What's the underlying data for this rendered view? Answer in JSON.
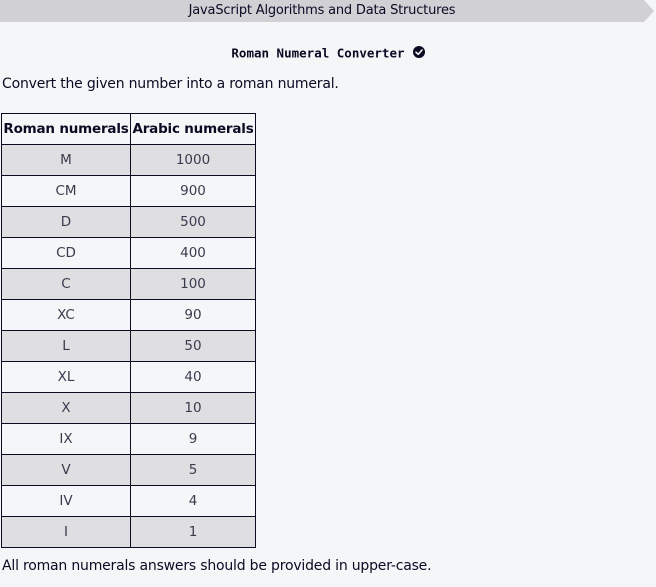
{
  "breadcrumb": {
    "text": "JavaScript Algorithms and Data Structures"
  },
  "challenge": {
    "title": "Roman Numeral Converter",
    "completed": true
  },
  "description": {
    "intro": "Convert the given number into a roman numeral.",
    "footer": "All roman numerals answers should be provided in upper-case."
  },
  "table": {
    "headers": [
      "Roman numerals",
      "Arabic numerals"
    ],
    "rows": [
      {
        "roman": "M",
        "arabic": "1000"
      },
      {
        "roman": "CM",
        "arabic": "900"
      },
      {
        "roman": "D",
        "arabic": "500"
      },
      {
        "roman": "CD",
        "arabic": "400"
      },
      {
        "roman": "C",
        "arabic": "100"
      },
      {
        "roman": "XC",
        "arabic": "90"
      },
      {
        "roman": "L",
        "arabic": "50"
      },
      {
        "roman": "XL",
        "arabic": "40"
      },
      {
        "roman": "X",
        "arabic": "10"
      },
      {
        "roman": "IX",
        "arabic": "9"
      },
      {
        "roman": "V",
        "arabic": "5"
      },
      {
        "roman": "IV",
        "arabic": "4"
      },
      {
        "roman": "I",
        "arabic": "1"
      }
    ]
  },
  "colors": {
    "background": "#f5f6f7",
    "breadcrumb_bg": "#d0d0d5",
    "row_alt": "#dfdfe2",
    "text": "#0a0a23"
  }
}
